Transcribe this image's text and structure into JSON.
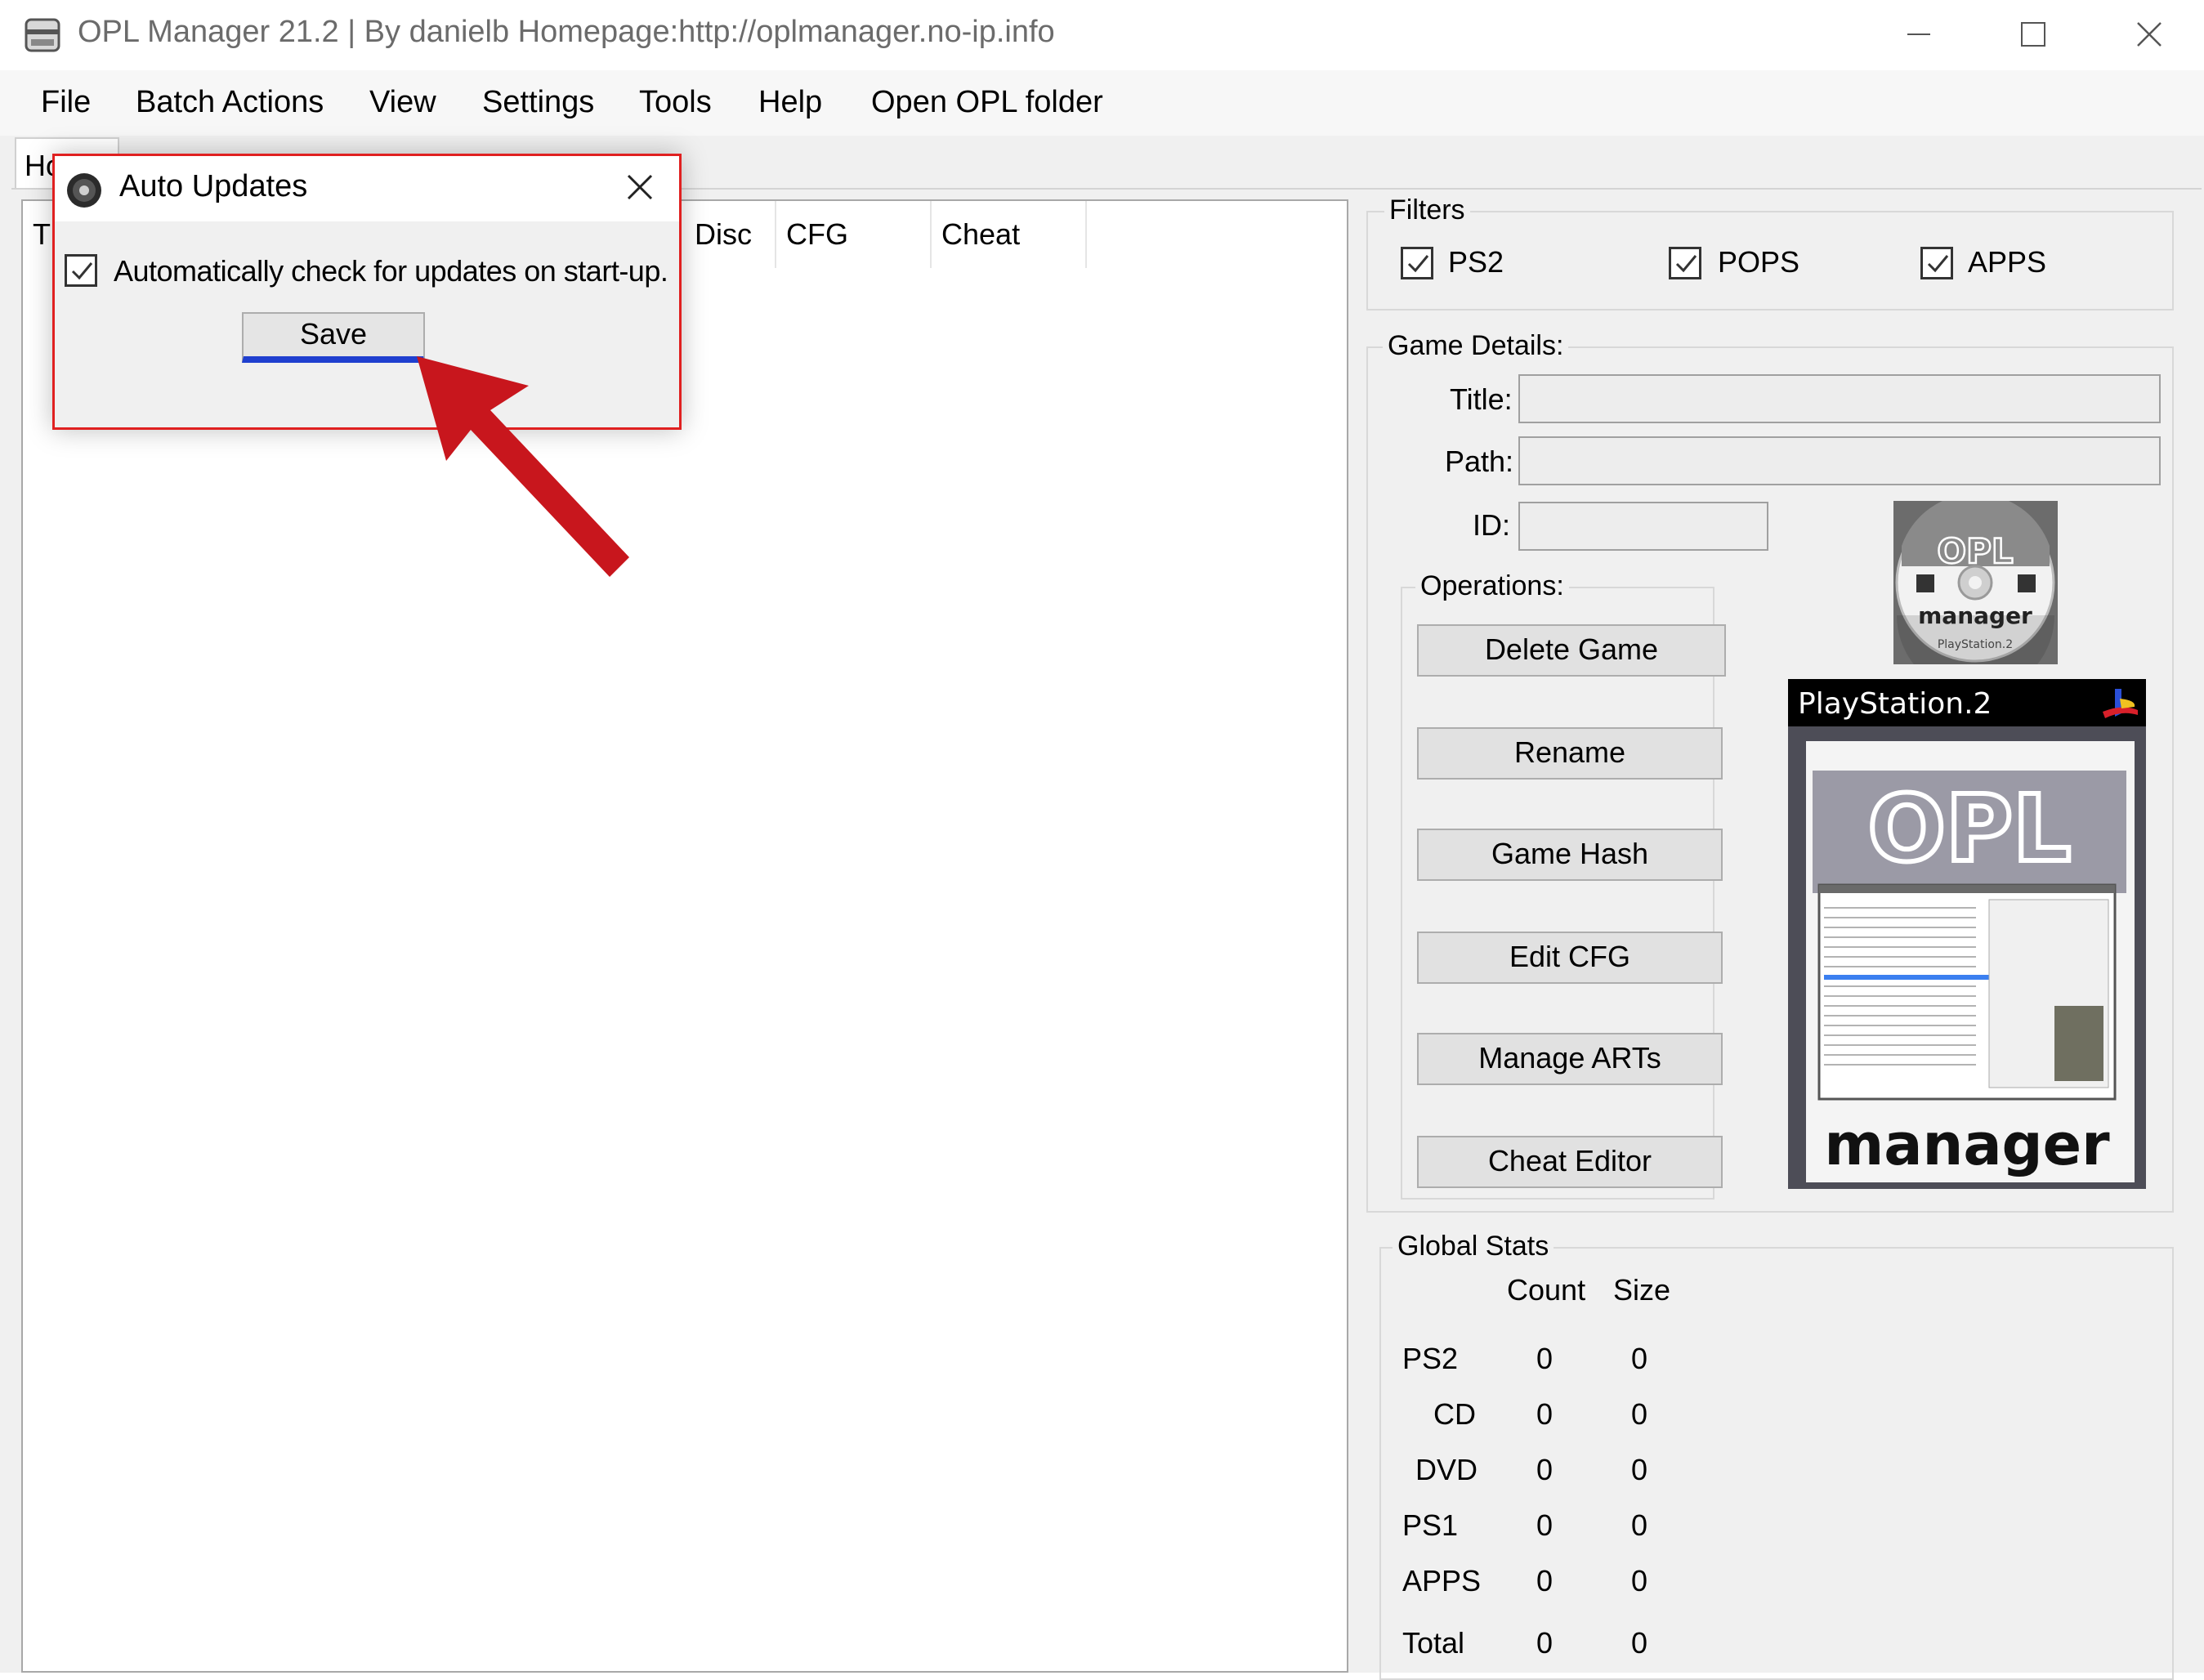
{
  "window": {
    "title": "OPL Manager 21.2 | By danielb Homepage:http://oplmanager.no-ip.info",
    "icon": "app-icon",
    "controls": [
      "minimize-icon",
      "maximize-icon",
      "close-icon"
    ]
  },
  "menu": {
    "file": "File",
    "batch_actions": "Batch Actions",
    "view": "View",
    "settings": "Settings",
    "tools": "Tools",
    "help": "Help",
    "open_opl_folder": "Open OPL folder"
  },
  "tabs": {
    "home": "Home"
  },
  "game_list": {
    "columns": [
      "T",
      "Disc",
      "CFG",
      "Cheat"
    ]
  },
  "filters": {
    "title": "Filters",
    "ps2": {
      "label": "PS2",
      "checked": true
    },
    "pops": {
      "label": "POPS",
      "checked": true
    },
    "apps": {
      "label": "APPS",
      "checked": true
    }
  },
  "game_details": {
    "title": "Game Details:",
    "title_label": "Title:",
    "title_value": "",
    "path_label": "Path:",
    "path_value": "",
    "id_label": "ID:",
    "id_value": ""
  },
  "operations": {
    "title": "Operations:",
    "delete_game": "Delete Game",
    "rename": "Rename",
    "game_hash": "Game Hash",
    "edit_cfg": "Edit CFG",
    "manage_arts": "Manage ARTs",
    "cheat_editor": "Cheat Editor"
  },
  "logos": {
    "disc_text_top": "OPL",
    "disc_text_mid": "manager",
    "disc_text_bottom": "PlayStation.2",
    "cover_header": "PlayStation.2",
    "cover_logo": "OPL",
    "cover_footer": "manager"
  },
  "global_stats": {
    "title": "Global Stats",
    "count_header": "Count",
    "size_header": "Size",
    "rows": [
      {
        "label": "PS2",
        "count": "0",
        "size": "0"
      },
      {
        "label": "CD",
        "count": "0",
        "size": "0"
      },
      {
        "label": "DVD",
        "count": "0",
        "size": "0"
      },
      {
        "label": "PS1",
        "count": "0",
        "size": "0"
      },
      {
        "label": "APPS",
        "count": "0",
        "size": "0"
      },
      {
        "label": "Total",
        "count": "0",
        "size": "0"
      }
    ]
  },
  "dialog": {
    "title": "Auto Updates",
    "checkbox_label": "Automatically check for updates on start-up.",
    "checkbox_checked": true,
    "save": "Save",
    "highlight_color": "#e02020",
    "annotation_arrow_color": "#c8161d"
  }
}
